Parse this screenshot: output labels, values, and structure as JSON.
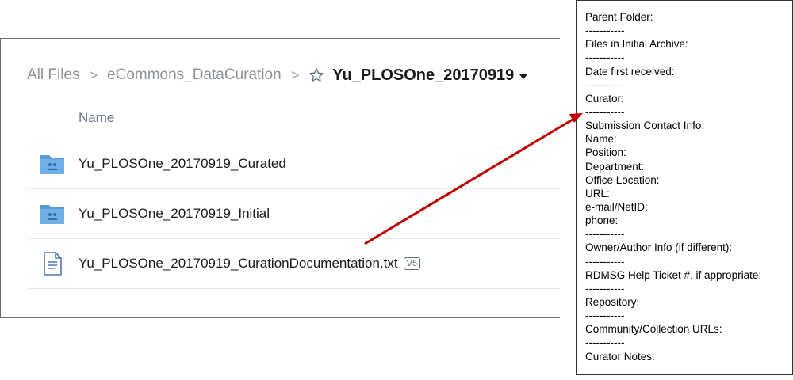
{
  "breadcrumb": {
    "items": [
      {
        "label": "All Files"
      },
      {
        "label": "eCommons_DataCuration"
      },
      {
        "label": "Yu_PLOSOne_20170919"
      }
    ],
    "separator": ">",
    "current_icons": [
      "star-icon",
      "caret-down-icon"
    ]
  },
  "table": {
    "header": "Name",
    "rows": [
      {
        "name": "Yu_PLOSOne_20170919_Curated",
        "type": "shared-folder",
        "icon": "shared-folder-icon"
      },
      {
        "name": "Yu_PLOSOne_20170919_Initial",
        "type": "shared-folder",
        "icon": "shared-folder-icon"
      },
      {
        "name": "Yu_PLOSOne_20170919_CurationDocumentation.txt",
        "type": "text-file",
        "icon": "text-file-icon",
        "version": "V5"
      }
    ]
  },
  "template": {
    "lines": [
      "Parent Folder:",
      "-----------",
      "Files in Initial  Archive:",
      "-----------",
      "Date first received:",
      "-----------",
      "Curator:",
      "-----------",
      "Submission Contact Info:",
      "Name:",
      "Position:",
      "Department:",
      "Office Location:",
      "URL:",
      "e-mail/NetID:",
      "phone:",
      "-----------",
      "Owner/Author Info  (if different):",
      "-----------",
      "RDMSG Help Ticket #, if appropriate:",
      "-----------",
      "Repository:",
      "-----------",
      "Community/Collection URLs:",
      "-----------",
      "Curator Notes:"
    ]
  },
  "colors": {
    "arrow": "#c00000",
    "folder": "#5b9bd5",
    "text_primary": "#1e1919",
    "text_secondary": "#637282"
  }
}
